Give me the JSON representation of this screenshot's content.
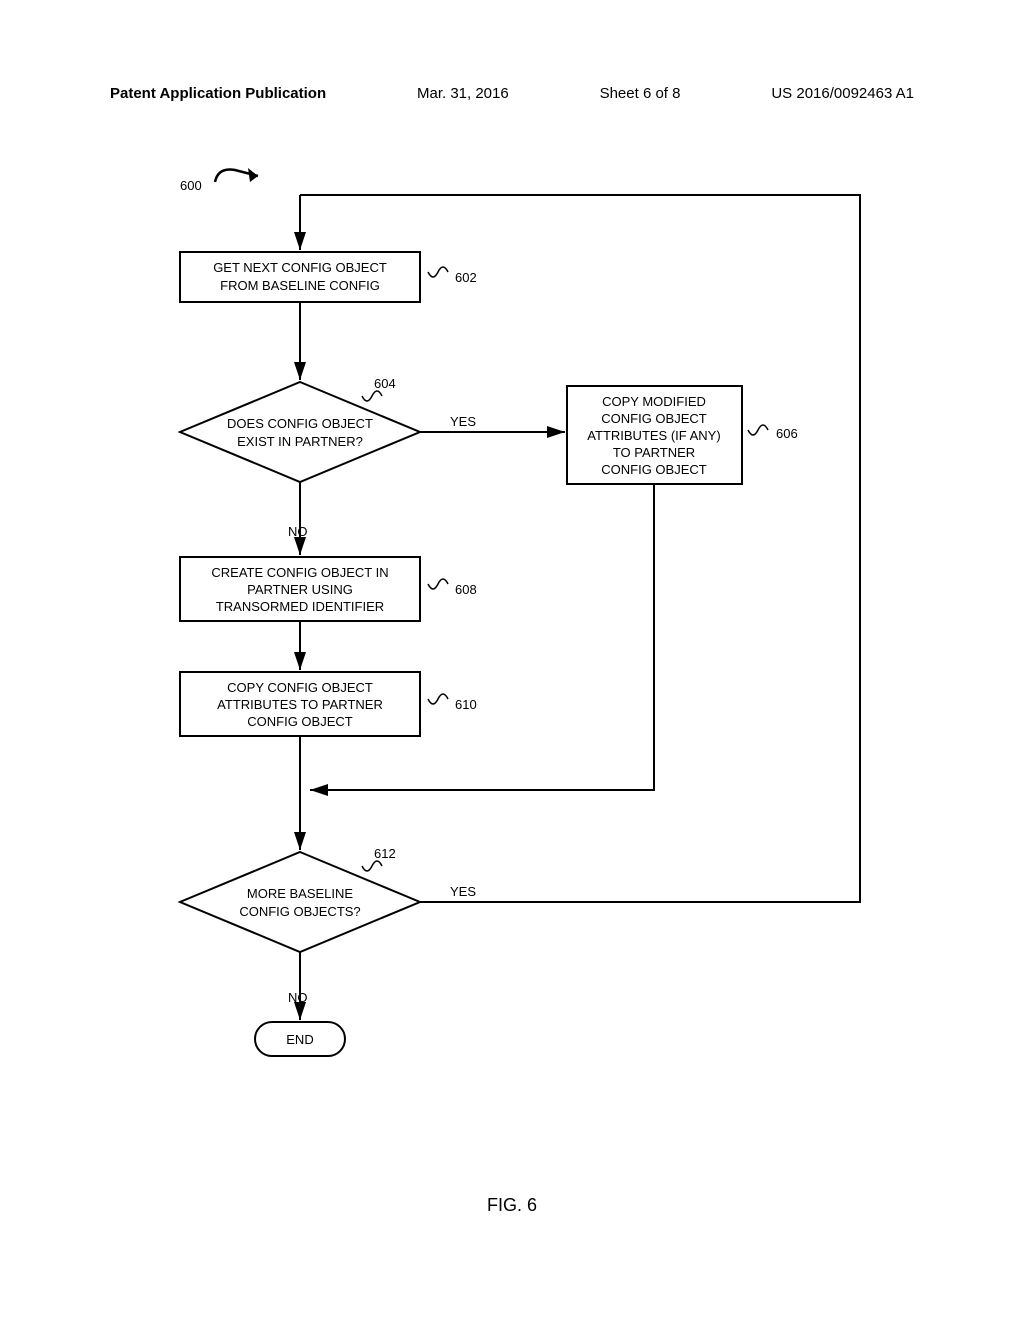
{
  "header": {
    "left": "Patent Application Publication",
    "date": "Mar. 31, 2016",
    "sheet": "Sheet 6 of 8",
    "docnum": "US 2016/0092463 A1"
  },
  "figure_label": "FIG. 6",
  "chart_data": {
    "type": "flowchart",
    "diagram_ref": "600",
    "nodes": [
      {
        "id": "602",
        "ref": "602",
        "type": "process",
        "text": [
          "GET NEXT CONFIG OBJECT",
          "FROM BASELINE CONFIG"
        ]
      },
      {
        "id": "604",
        "ref": "604",
        "type": "decision",
        "text": [
          "DOES CONFIG OBJECT",
          "EXIST IN PARTNER?"
        ]
      },
      {
        "id": "606",
        "ref": "606",
        "type": "process",
        "text": [
          "COPY MODIFIED",
          "CONFIG OBJECT",
          "ATTRIBUTES (IF ANY)",
          "TO PARTNER",
          "CONFIG OBJECT"
        ]
      },
      {
        "id": "608",
        "ref": "608",
        "type": "process",
        "text": [
          "CREATE CONFIG OBJECT IN",
          "PARTNER USING",
          "TRANSORMED IDENTIFIER"
        ]
      },
      {
        "id": "610",
        "ref": "610",
        "type": "process",
        "text": [
          "COPY CONFIG OBJECT",
          "ATTRIBUTES TO PARTNER",
          "CONFIG OBJECT"
        ]
      },
      {
        "id": "612",
        "ref": "612",
        "type": "decision",
        "text": [
          "MORE BASELINE",
          "CONFIG OBJECTS?"
        ]
      },
      {
        "id": "end",
        "type": "terminator",
        "text": [
          "END"
        ]
      }
    ],
    "edges": [
      {
        "from": "start",
        "to": "602"
      },
      {
        "from": "602",
        "to": "604"
      },
      {
        "from": "604",
        "to": "606",
        "label": "YES"
      },
      {
        "from": "604",
        "to": "608",
        "label": "NO"
      },
      {
        "from": "608",
        "to": "610"
      },
      {
        "from": "610",
        "to": "612"
      },
      {
        "from": "606",
        "to": "612"
      },
      {
        "from": "612",
        "to": "602",
        "label": "YES"
      },
      {
        "from": "612",
        "to": "end",
        "label": "NO"
      }
    ],
    "labels": {
      "yes": "YES",
      "no": "NO"
    }
  }
}
